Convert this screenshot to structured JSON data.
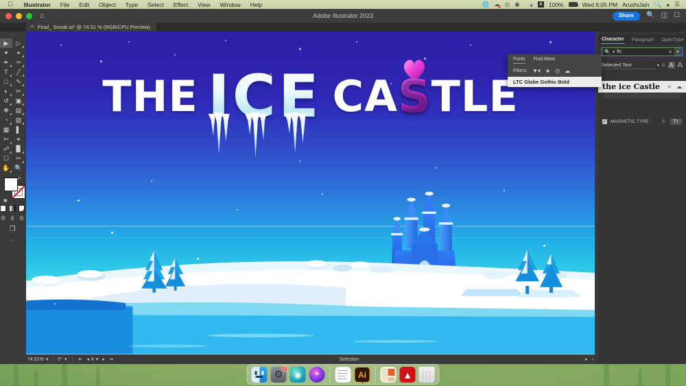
{
  "menubar": {
    "apple_icon": "apple-icon",
    "items": [
      {
        "label": "Illustrator",
        "bold": true
      },
      {
        "label": "File",
        "bold": false
      },
      {
        "label": "Edit",
        "bold": false
      },
      {
        "label": "Object",
        "bold": false
      },
      {
        "label": "Type",
        "bold": false
      },
      {
        "label": "Select",
        "bold": false
      },
      {
        "label": "Effect",
        "bold": false
      },
      {
        "label": "View",
        "bold": false
      },
      {
        "label": "Window",
        "bold": false
      },
      {
        "label": "Help",
        "bold": false
      }
    ],
    "status": {
      "battery_percent": "100%",
      "datetime": "Wed 6:05 PM",
      "user": "ArushiJain",
      "icons": [
        "globe-icon",
        "dropbox-icon",
        "sync-icon",
        "vpn-icon",
        "bluetooth-icon",
        "wifi-icon",
        "app-store-icon",
        "spotlight-search-icon",
        "siri-icon",
        "control-center-icon"
      ]
    }
  },
  "window": {
    "app_title": "Adobe Illustrator 2023",
    "share_label": "Share",
    "traffic_lights": [
      "close-button",
      "minimize-button",
      "zoom-button"
    ],
    "home_icon": "home-icon",
    "search_icon": "search-icon",
    "arrange_icon": "arrange-documents-icon",
    "workspace_icon": "workspace-switcher-icon",
    "tab": {
      "close_icon": "close-tab-icon",
      "title": "Final_ Sneak.ai* @ 74.51 % (RGB/CPU Preview)"
    }
  },
  "toolbar": {
    "grip": "⋯",
    "tools": [
      {
        "name": "selection-tool",
        "selected": true
      },
      {
        "name": "direct-selection-tool",
        "selected": false
      },
      {
        "name": "magic-wand-tool",
        "selected": false
      },
      {
        "name": "lasso-tool",
        "selected": false
      },
      {
        "name": "pen-tool",
        "selected": false
      },
      {
        "name": "curvature-tool",
        "selected": false
      },
      {
        "name": "type-tool",
        "selected": false
      },
      {
        "name": "line-segment-tool",
        "selected": false
      },
      {
        "name": "rectangle-tool",
        "selected": false
      },
      {
        "name": "paintbrush-tool",
        "selected": false
      },
      {
        "name": "shaper-tool",
        "selected": false
      },
      {
        "name": "scissors-tool",
        "selected": false
      },
      {
        "name": "rotate-tool",
        "selected": false
      },
      {
        "name": "scale-tool",
        "selected": false
      },
      {
        "name": "width-tool",
        "selected": false
      },
      {
        "name": "free-transform-tool",
        "selected": false
      },
      {
        "name": "shape-builder-tool",
        "selected": false
      },
      {
        "name": "perspective-grid-tool",
        "selected": false
      },
      {
        "name": "mesh-tool",
        "selected": false
      },
      {
        "name": "gradient-tool",
        "selected": false
      },
      {
        "name": "eyedropper-tool",
        "selected": false
      },
      {
        "name": "blend-tool",
        "selected": false
      },
      {
        "name": "symbol-sprayer-tool",
        "selected": false
      },
      {
        "name": "column-graph-tool",
        "selected": false
      },
      {
        "name": "artboard-tool",
        "selected": false
      },
      {
        "name": "slice-tool",
        "selected": false
      },
      {
        "name": "hand-tool",
        "selected": false
      },
      {
        "name": "zoom-tool",
        "selected": false
      }
    ],
    "fill_color": "#ffffff",
    "stroke_color": "none",
    "dots": "⋯"
  },
  "canvas": {
    "artwork_title_words": [
      {
        "text": "THE",
        "style": "white"
      },
      {
        "text": "ICE",
        "style": "ice"
      },
      {
        "text": "CA",
        "style": "white"
      },
      {
        "text": "S",
        "style": "magenta"
      },
      {
        "text": "TLE",
        "style": "white"
      }
    ],
    "scene": "ice-castle-winter-landscape",
    "accent_magenta": "#e83ad6",
    "sky_top": "#2c21a8",
    "sky_bottom": "#eafbfd"
  },
  "statusbar": {
    "zoom_level": "74.51%",
    "rotation": "0°",
    "artboard_number": "4",
    "tool_indicator": "Selection",
    "first_icon": "first-artboard-icon",
    "prev_icon": "previous-artboard-icon",
    "next_icon": "next-artboard-icon",
    "last_icon": "last-artboard-icon",
    "play_icon": "play-icon",
    "chevron": "chevron-left-icon"
  },
  "character_panel": {
    "tabs": [
      {
        "label": "Character",
        "active": true
      },
      {
        "label": "Paragraph",
        "active": false
      },
      {
        "label": "OpenType",
        "active": false
      }
    ],
    "menu_icon": "panel-menu-icon",
    "font_search": {
      "value": "ltc",
      "search_icon": "search-icon",
      "clear_icon": "clear-icon",
      "dropdown_icon": "chevron-down-icon"
    },
    "filter_scope": "Selected Text",
    "font_preview_text": "the ice Castle",
    "preview_similar_icon": "similar-fonts-icon",
    "cloud_icon": "cloud-icon",
    "magnetic_type_label": "MAGNETIC TYPE",
    "magnetic_type_checked": true,
    "touch_type_label": "Tт",
    "size_small_icon": "small-size-icon",
    "size_mid_icon": "medium-size-icon",
    "size_large_icon": "large-size-icon"
  },
  "font_dropdown": {
    "tabs": [
      {
        "label": "Fonts",
        "active": true
      },
      {
        "label": "Find More",
        "active": false
      }
    ],
    "filters_label": "Filters:",
    "filter_icons": [
      "filter-icon",
      "favorites-star-icon",
      "recent-clock-icon",
      "cloud-fonts-icon"
    ],
    "results": [
      {
        "name": "LTC Globe Gothic Bold",
        "selected": true
      }
    ]
  },
  "dock": {
    "items": [
      {
        "name": "finder",
        "badge": "",
        "running": true
      },
      {
        "name": "system-preferences",
        "badge": "2",
        "running": false
      },
      {
        "name": "creative-cloud",
        "badge": "",
        "running": false
      },
      {
        "name": "siri",
        "badge": "",
        "running": false
      },
      {
        "name": "textedit",
        "badge": "",
        "running": false
      },
      {
        "name": "adobe-illustrator",
        "badge": "",
        "running": true
      },
      {
        "name": "notes-stickies",
        "badge": "",
        "running": false
      },
      {
        "name": "adobe-acrobat",
        "badge": "",
        "running": false
      },
      {
        "name": "trash",
        "badge": "",
        "running": false
      }
    ]
  }
}
